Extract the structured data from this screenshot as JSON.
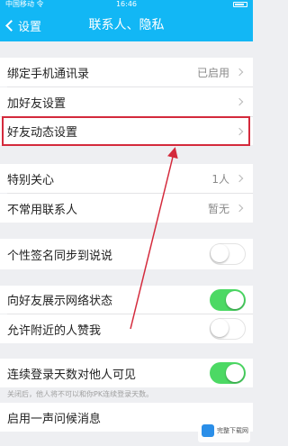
{
  "status_bar": {
    "carrier": "中国移动 令",
    "time": "16:46"
  },
  "nav": {
    "back_label": "设置",
    "title": "联系人、隐私"
  },
  "rows": {
    "bind_contacts": {
      "label": "绑定手机通讯录",
      "value": "已启用"
    },
    "add_friend": {
      "label": "加好友设置"
    },
    "friend_feed": {
      "label": "好友动态设置"
    },
    "special_care": {
      "label": "特别关心",
      "value": "1人"
    },
    "rare_contacts": {
      "label": "不常用联系人",
      "value": "暂无"
    },
    "signature_sync": {
      "label": "个性签名同步到说说",
      "toggle": "off"
    },
    "show_network": {
      "label": "向好友展示网络状态",
      "toggle": "on"
    },
    "nearby_likes": {
      "label": "允许附近的人赞我",
      "toggle": "off"
    },
    "login_days": {
      "label": "连续登录天数对他人可见",
      "toggle": "on"
    },
    "greeting": {
      "label": "启用一声问候消息"
    }
  },
  "footnote": "关闭后，他人将不可以和你PK连续登录天数。",
  "watermark": {
    "text": "完整下载网"
  },
  "colors": {
    "nav": "#12b7f5",
    "toggle_on": "#4cd964",
    "highlight": "#d42a3c"
  }
}
